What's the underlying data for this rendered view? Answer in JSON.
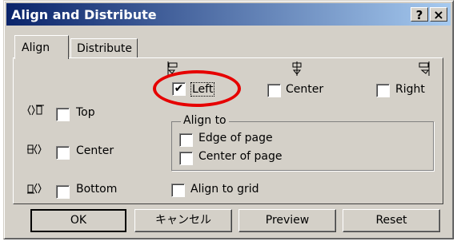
{
  "window": {
    "title": "Align and Distribute",
    "help_label": "?",
    "close_label": "×"
  },
  "tabs": [
    {
      "label": "Align",
      "active": true
    },
    {
      "label": "Distribute",
      "active": false
    }
  ],
  "horizontal": {
    "left": {
      "label": "Left",
      "checked": true,
      "check_glyph": "✔",
      "icon": "align-left-icon"
    },
    "center": {
      "label": "Center",
      "checked": false,
      "icon": "align-center-horizontal-icon"
    },
    "right": {
      "label": "Right",
      "checked": false,
      "icon": "align-right-icon"
    }
  },
  "vertical": {
    "top": {
      "label": "Top",
      "checked": false,
      "icon": "align-top-icon"
    },
    "center": {
      "label": "Center",
      "checked": false,
      "icon": "align-center-vertical-icon"
    },
    "bottom": {
      "label": "Bottom",
      "checked": false,
      "icon": "align-bottom-icon"
    }
  },
  "align_to": {
    "title": "Align to",
    "edge_of_page": {
      "label": "Edge of page",
      "checked": false
    },
    "center_of_page": {
      "label": "Center of page",
      "checked": false
    }
  },
  "align_to_grid": {
    "label": "Align to grid",
    "checked": false
  },
  "buttons": {
    "ok": "OK",
    "cancel": "キャンセル",
    "preview": "Preview",
    "reset": "Reset"
  },
  "colors": {
    "titlebar_start": "#0a246a",
    "titlebar_end": "#a6caf0",
    "face": "#d4d0c8",
    "annotation": "#e60000"
  }
}
